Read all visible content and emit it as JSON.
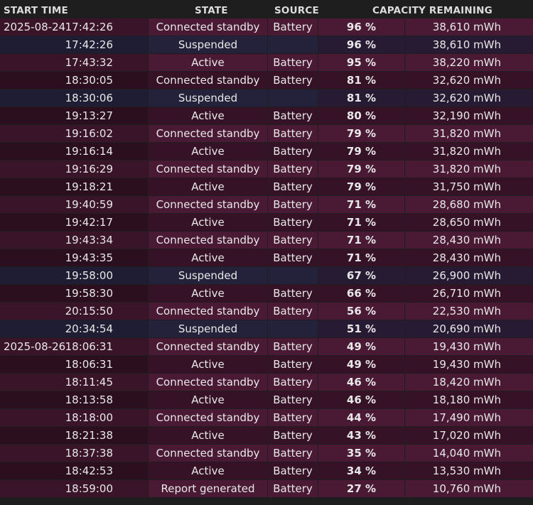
{
  "header": {
    "start_time": "START TIME",
    "state": "STATE",
    "source": "SOURCE",
    "capacity": "CAPACITY REMAINING"
  },
  "rows": [
    {
      "date": "2025-08-24",
      "time": "17:42:26",
      "state": "Connected standby",
      "source": "Battery",
      "percent": "96 %",
      "mwh": "38,610 mWh",
      "shade": "a"
    },
    {
      "date": "",
      "time": "17:42:26",
      "state": "Suspended",
      "source": "",
      "percent": "96 %",
      "mwh": "38,610 mWh",
      "shade": "sus"
    },
    {
      "date": "",
      "time": "17:43:32",
      "state": "Active",
      "source": "Battery",
      "percent": "95 %",
      "mwh": "38,220 mWh",
      "shade": "a"
    },
    {
      "date": "",
      "time": "18:30:05",
      "state": "Connected standby",
      "source": "Battery",
      "percent": "81 %",
      "mwh": "32,620 mWh",
      "shade": "b"
    },
    {
      "date": "",
      "time": "18:30:06",
      "state": "Suspended",
      "source": "",
      "percent": "81 %",
      "mwh": "32,620 mWh",
      "shade": "sus"
    },
    {
      "date": "",
      "time": "19:13:27",
      "state": "Active",
      "source": "Battery",
      "percent": "80 %",
      "mwh": "32,190 mWh",
      "shade": "b"
    },
    {
      "date": "",
      "time": "19:16:02",
      "state": "Connected standby",
      "source": "Battery",
      "percent": "79 %",
      "mwh": "31,820 mWh",
      "shade": "a"
    },
    {
      "date": "",
      "time": "19:16:14",
      "state": "Active",
      "source": "Battery",
      "percent": "79 %",
      "mwh": "31,820 mWh",
      "shade": "b"
    },
    {
      "date": "",
      "time": "19:16:29",
      "state": "Connected standby",
      "source": "Battery",
      "percent": "79 %",
      "mwh": "31,820 mWh",
      "shade": "a"
    },
    {
      "date": "",
      "time": "19:18:21",
      "state": "Active",
      "source": "Battery",
      "percent": "79 %",
      "mwh": "31,750 mWh",
      "shade": "b"
    },
    {
      "date": "",
      "time": "19:40:59",
      "state": "Connected standby",
      "source": "Battery",
      "percent": "71 %",
      "mwh": "28,680 mWh",
      "shade": "a"
    },
    {
      "date": "",
      "time": "19:42:17",
      "state": "Active",
      "source": "Battery",
      "percent": "71 %",
      "mwh": "28,650 mWh",
      "shade": "b"
    },
    {
      "date": "",
      "time": "19:43:34",
      "state": "Connected standby",
      "source": "Battery",
      "percent": "71 %",
      "mwh": "28,430 mWh",
      "shade": "a"
    },
    {
      "date": "",
      "time": "19:43:35",
      "state": "Active",
      "source": "Battery",
      "percent": "71 %",
      "mwh": "28,430 mWh",
      "shade": "b"
    },
    {
      "date": "",
      "time": "19:58:00",
      "state": "Suspended",
      "source": "",
      "percent": "67 %",
      "mwh": "26,900 mWh",
      "shade": "sus"
    },
    {
      "date": "",
      "time": "19:58:30",
      "state": "Active",
      "source": "Battery",
      "percent": "66 %",
      "mwh": "26,710 mWh",
      "shade": "b"
    },
    {
      "date": "",
      "time": "20:15:50",
      "state": "Connected standby",
      "source": "Battery",
      "percent": "56 %",
      "mwh": "22,530 mWh",
      "shade": "a"
    },
    {
      "date": "",
      "time": "20:34:54",
      "state": "Suspended",
      "source": "",
      "percent": "51 %",
      "mwh": "20,690 mWh",
      "shade": "sus"
    },
    {
      "date": "2025-08-26",
      "time": "18:06:31",
      "state": "Connected standby",
      "source": "Battery",
      "percent": "49 %",
      "mwh": "19,430 mWh",
      "shade": "a"
    },
    {
      "date": "",
      "time": "18:06:31",
      "state": "Active",
      "source": "Battery",
      "percent": "49 %",
      "mwh": "19,430 mWh",
      "shade": "b"
    },
    {
      "date": "",
      "time": "18:11:45",
      "state": "Connected standby",
      "source": "Battery",
      "percent": "46 %",
      "mwh": "18,420 mWh",
      "shade": "a"
    },
    {
      "date": "",
      "time": "18:13:58",
      "state": "Active",
      "source": "Battery",
      "percent": "46 %",
      "mwh": "18,180 mWh",
      "shade": "b"
    },
    {
      "date": "",
      "time": "18:18:00",
      "state": "Connected standby",
      "source": "Battery",
      "percent": "44 %",
      "mwh": "17,490 mWh",
      "shade": "a"
    },
    {
      "date": "",
      "time": "18:21:38",
      "state": "Active",
      "source": "Battery",
      "percent": "43 %",
      "mwh": "17,020 mWh",
      "shade": "b"
    },
    {
      "date": "",
      "time": "18:37:38",
      "state": "Connected standby",
      "source": "Battery",
      "percent": "35 %",
      "mwh": "14,040 mWh",
      "shade": "a"
    },
    {
      "date": "",
      "time": "18:42:53",
      "state": "Active",
      "source": "Battery",
      "percent": "34 %",
      "mwh": "13,530 mWh",
      "shade": "b"
    },
    {
      "date": "",
      "time": "18:59:00",
      "state": "Report generated",
      "source": "Battery",
      "percent": "27 %",
      "mwh": "10,760 mWh",
      "shade": "a"
    }
  ]
}
